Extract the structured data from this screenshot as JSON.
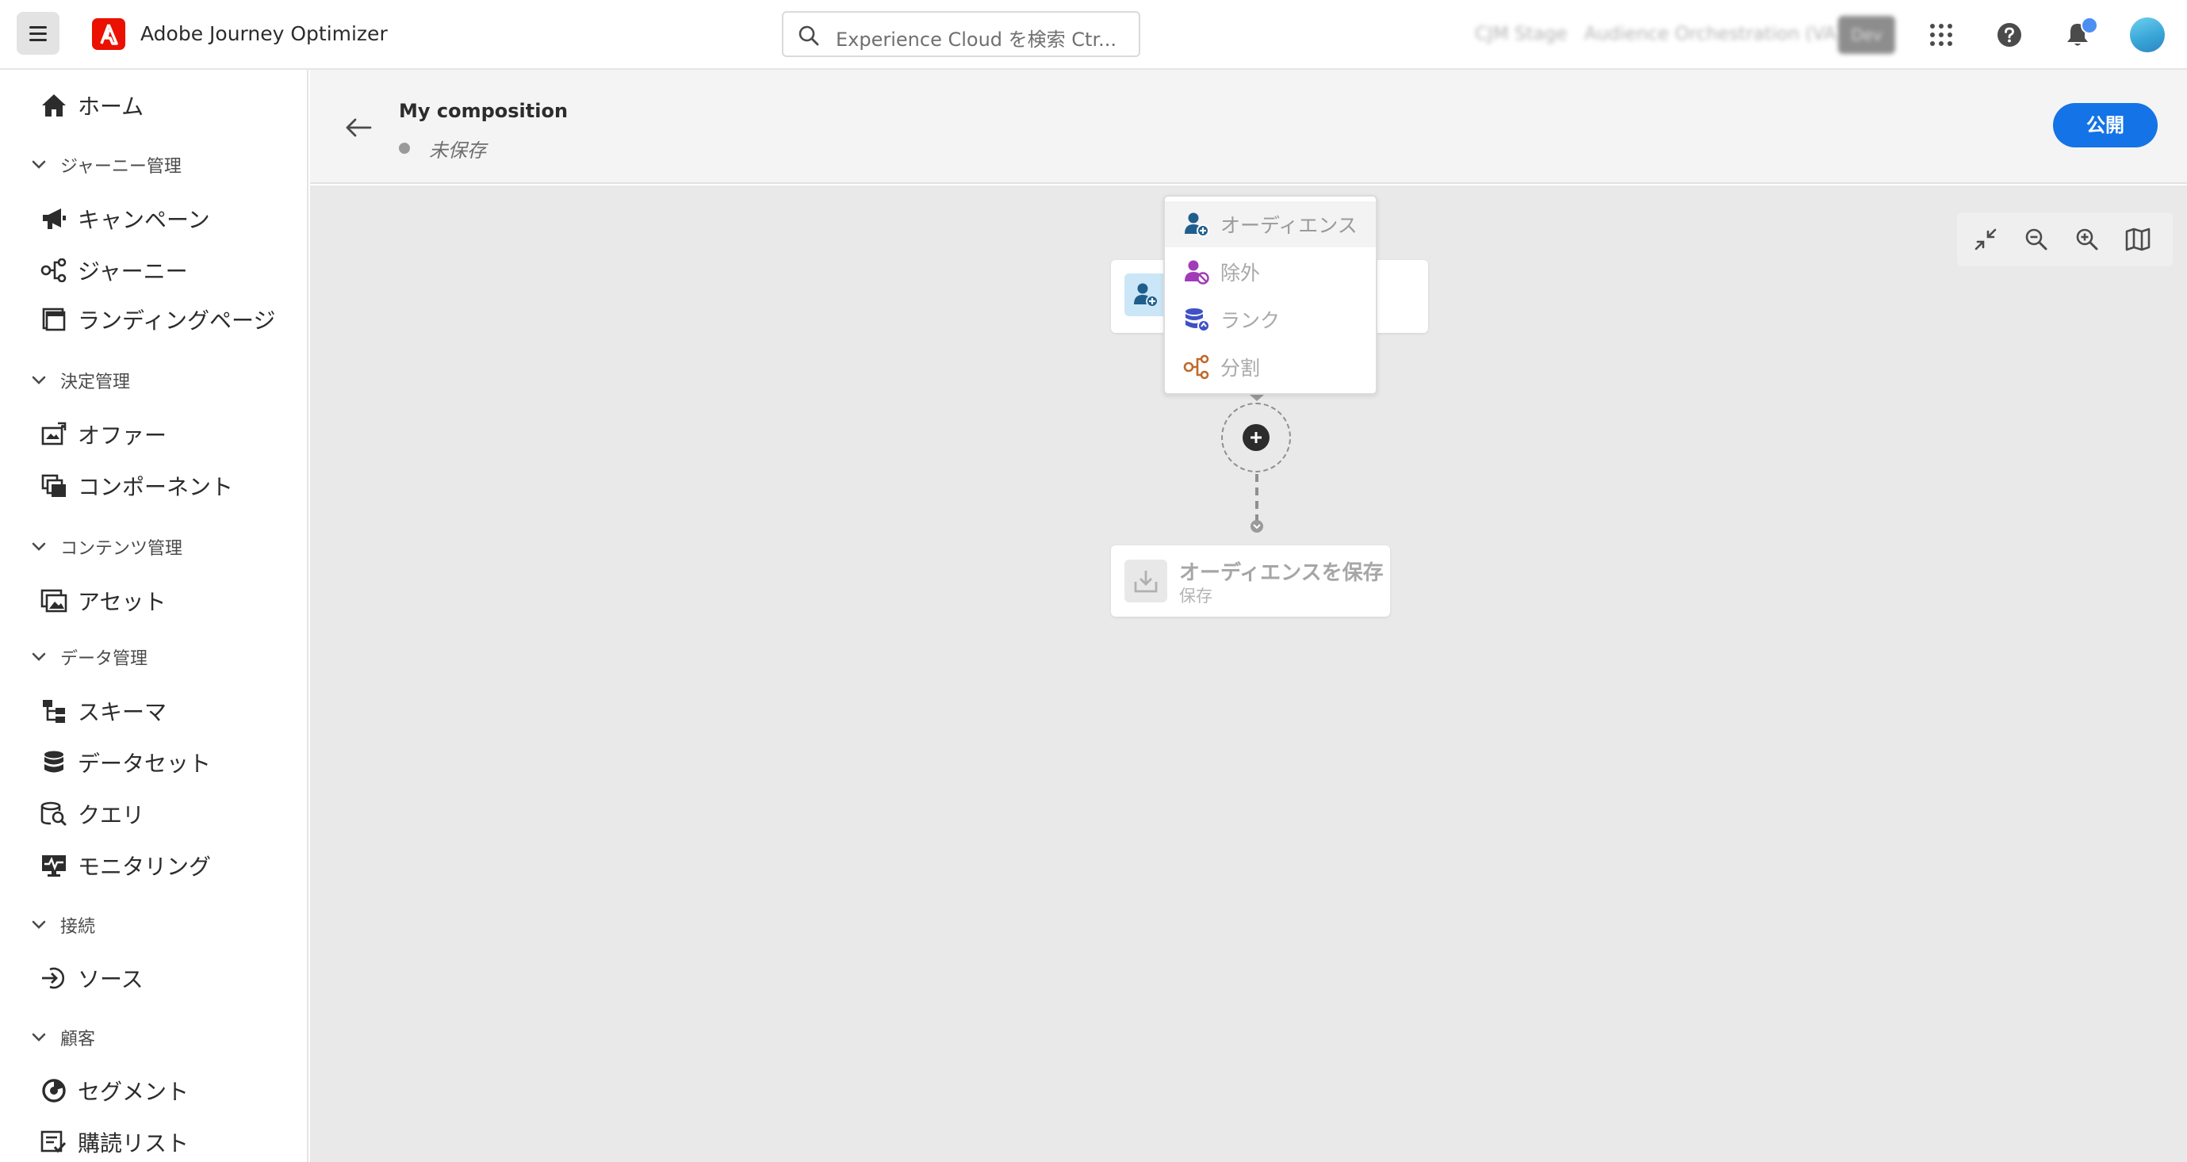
{
  "app": {
    "title": "Adobe Journey Optimizer"
  },
  "search": {
    "placeholder": "Experience Cloud を検索 Ctr..."
  },
  "org": {
    "sandbox": "CJM Stage",
    "org_name": "Audience Orchestration (VA7)",
    "env": "Dev"
  },
  "sidebar": {
    "home": "ホーム",
    "groups": [
      {
        "label": "ジャーニー管理",
        "items": [
          {
            "label": "キャンペーン",
            "icon": "megaphone-icon"
          },
          {
            "label": "ジャーニー",
            "icon": "journey-icon"
          },
          {
            "label": "ランディングページ",
            "icon": "landing-page-icon"
          }
        ]
      },
      {
        "label": "決定管理",
        "items": [
          {
            "label": "オファー",
            "icon": "offer-icon"
          },
          {
            "label": "コンポーネント",
            "icon": "components-icon"
          }
        ]
      },
      {
        "label": "コンテンツ管理",
        "items": [
          {
            "label": "アセット",
            "icon": "assets-icon"
          }
        ]
      },
      {
        "label": "データ管理",
        "items": [
          {
            "label": "スキーマ",
            "icon": "schema-icon"
          },
          {
            "label": "データセット",
            "icon": "dataset-icon"
          },
          {
            "label": "クエリ",
            "icon": "query-icon"
          },
          {
            "label": "モニタリング",
            "icon": "monitoring-icon"
          }
        ]
      },
      {
        "label": "接続",
        "items": [
          {
            "label": "ソース",
            "icon": "sources-icon"
          }
        ]
      },
      {
        "label": "顧客",
        "items": [
          {
            "label": "セグメント",
            "icon": "segment-icon"
          },
          {
            "label": "購読リスト",
            "icon": "subscription-list-icon"
          }
        ]
      }
    ]
  },
  "header": {
    "title": "My composition",
    "status": "未保存",
    "publish_label": "公開"
  },
  "canvas": {
    "menu": [
      {
        "label": "オーディエンス",
        "icon": "audience-add-icon",
        "color": "#1f5e8c"
      },
      {
        "label": "除外",
        "icon": "exclude-icon",
        "color": "#a13bb8"
      },
      {
        "label": "ランク",
        "icon": "rank-icon",
        "color": "#3f51c6"
      },
      {
        "label": "分割",
        "icon": "split-icon",
        "color": "#c06a2b"
      }
    ],
    "save_node": {
      "title": "オーディエンスを保存",
      "subtitle": "保存"
    }
  },
  "colors": {
    "accent": "#1473e6",
    "brand": "#eb1000",
    "canvas_bg": "#e9e9e9"
  }
}
